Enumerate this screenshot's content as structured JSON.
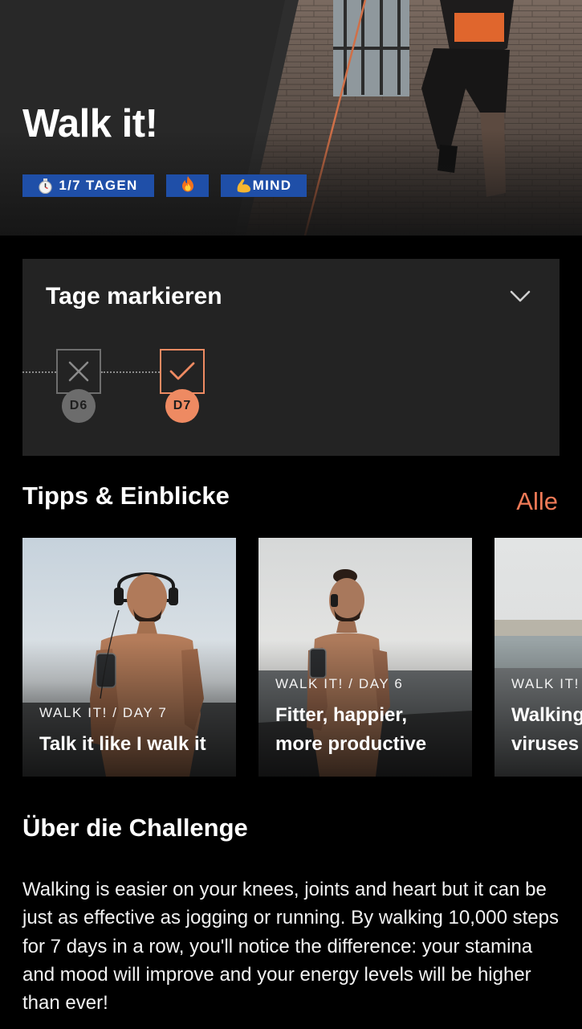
{
  "hero": {
    "title": "Walk it!",
    "badges": [
      {
        "icon": "stopwatch-icon",
        "label": "1/7 TAGEN"
      },
      {
        "icon": "fire-icon",
        "label": ""
      },
      {
        "icon": "flexed-biceps-icon",
        "label": "MIND"
      }
    ],
    "badge_color": "#1f4fa8"
  },
  "days_card": {
    "title": "Tage markieren",
    "expand_icon": "chevron-down-icon",
    "days": [
      {
        "label": "D6",
        "status": "missed",
        "icon": "cross-icon"
      },
      {
        "label": "D7",
        "status": "done",
        "icon": "checkmark-icon"
      }
    ],
    "accent": "#ee8a62"
  },
  "tips": {
    "title": "Tipps & Einblicke",
    "all_label": "Alle",
    "all_color": "#f07a57",
    "cards": [
      {
        "kicker": "WALK IT! / DAY 7",
        "title_lines": [
          "Talk it like I walk it"
        ]
      },
      {
        "kicker": "WALK IT! / DAY 6",
        "title_lines": [
          "Fitter, happier,",
          "more productive"
        ]
      },
      {
        "kicker": "WALK IT!",
        "title_lines": [
          "Walking",
          "viruses"
        ]
      }
    ]
  },
  "about": {
    "title": "Über die Challenge",
    "text": "Walking is easier on your knees, joints and heart but it can be just as effective as jogging or running. By walking 10,000 steps for 7 days in a row, you'll notice the difference: your stamina and mood will improve and your energy levels will be higher than ever!"
  }
}
